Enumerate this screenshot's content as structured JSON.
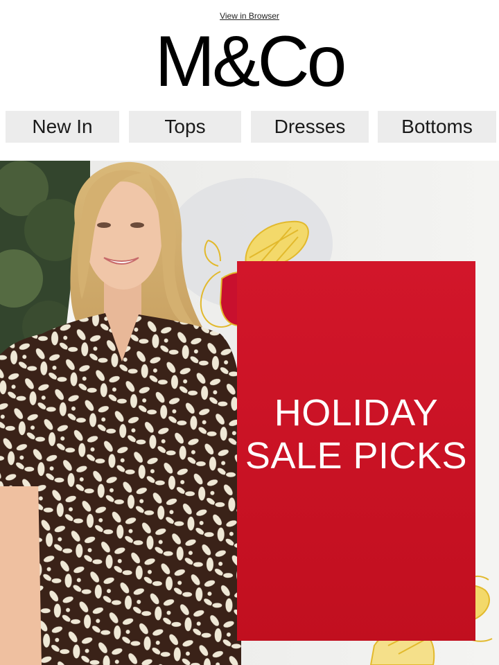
{
  "header": {
    "view_in_browser": "View in Browser",
    "logo_text": "M&Co"
  },
  "nav": {
    "items": [
      {
        "label": "New In"
      },
      {
        "label": "Tops"
      },
      {
        "label": "Dresses"
      },
      {
        "label": "Bottoms"
      }
    ]
  },
  "hero": {
    "headline_line1": "HOLIDAY",
    "headline_line2": "SALE PICKS",
    "box_color": "#c8102e",
    "accent_color": "#e9c13a"
  }
}
